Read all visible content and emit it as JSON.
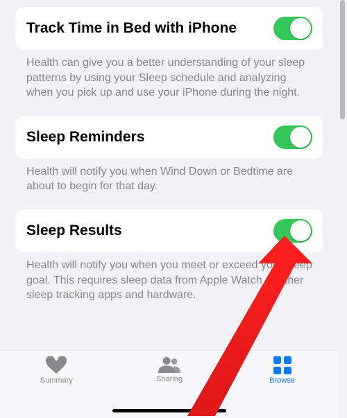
{
  "colors": {
    "accent": "#0a7aff",
    "toggle_on": "#34c759",
    "tab_inactive": "#8a8a8e",
    "footer": "#86858b",
    "bg": "#f2f1f6"
  },
  "sections": [
    {
      "title": "Track Time in Bed with iPhone",
      "description": "Health can give you a better understanding of your sleep patterns by using your Sleep schedule and analyzing when you pick up and use your iPhone during the night.",
      "on": true
    },
    {
      "title": "Sleep Reminders",
      "description": "Health will notify you when Wind Down or Bedtime are about to begin for that day.",
      "on": true
    },
    {
      "title": "Sleep Results",
      "description": "Health will notify you when you meet or exceed your sleep goal. This requires sleep data from Apple Watch or other sleep tracking apps and hardware.",
      "on": true
    }
  ],
  "tabs": {
    "summary": "Summary",
    "sharing": "Sharing",
    "browse": "Browse",
    "active": "browse"
  },
  "annotations": {
    "arrow_target": "sleep-results-toggle"
  }
}
